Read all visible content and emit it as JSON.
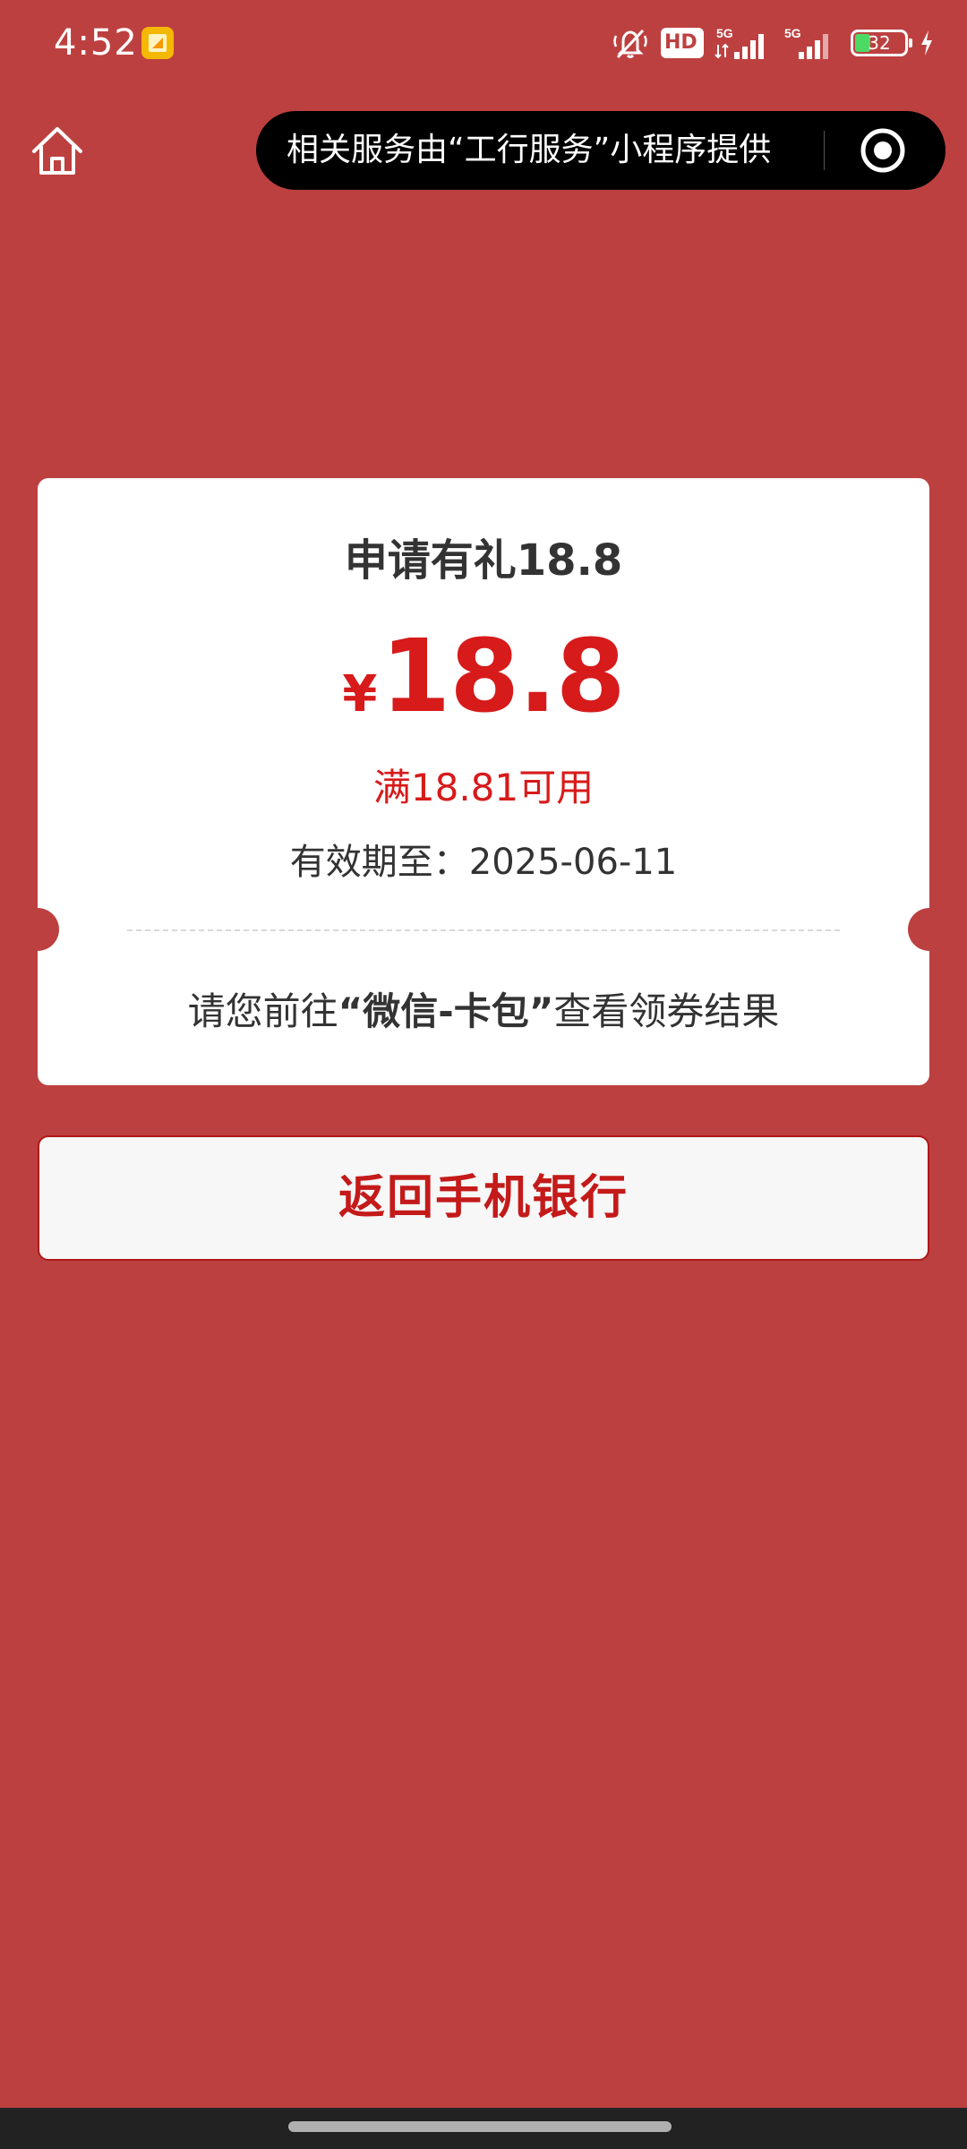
{
  "status_bar": {
    "time": "4:52",
    "hd_label": "HD",
    "network_1": "5G",
    "network_2": "5G",
    "battery_level": "32",
    "battery_fraction": 0.32
  },
  "nav": {
    "capsule_text": "相关服务由“工行服务”小程序提供",
    "icons": [
      "home-icon",
      "target-icon"
    ]
  },
  "coupon": {
    "title": "申请有礼18.8",
    "currency_symbol": "¥",
    "amount": "18.8",
    "condition": "满18.81可用",
    "validity": "有效期至：2025-06-11",
    "notice_prefix": "请您前往",
    "notice_bold": "“微信-卡包”",
    "notice_suffix": "查看领券结果"
  },
  "actions": {
    "return_label": "返回手机银行"
  },
  "colors": {
    "background": "#bd4040",
    "accent_red": "#d71a1a",
    "card": "#ffffff",
    "text": "#333333"
  }
}
